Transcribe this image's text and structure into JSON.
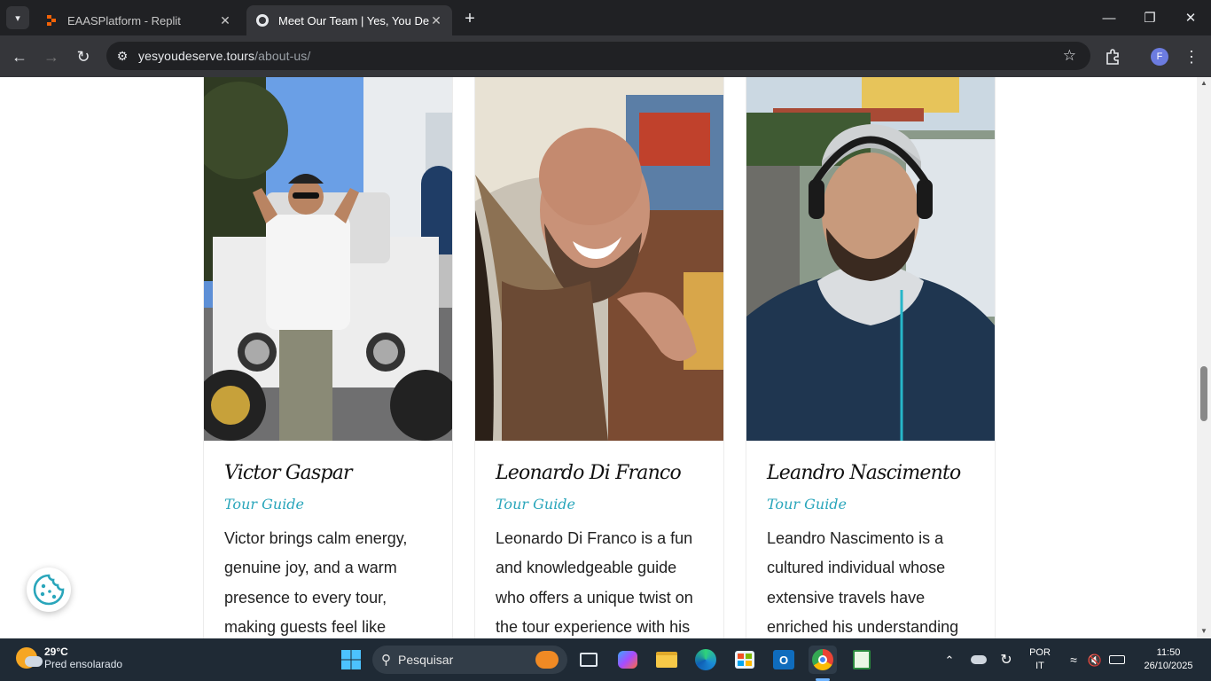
{
  "browser": {
    "tabs": [
      {
        "title": "EAASPlatform - Replit",
        "active": false
      },
      {
        "title": "Meet Our Team | Yes, You Deserve",
        "active": true
      }
    ],
    "url_domain": "yesyoudeserve.tours",
    "url_path": "/about-us/",
    "profile_initial": "F"
  },
  "team": [
    {
      "name": "Victor Gaspar",
      "role": "Tour Guide",
      "bio": "Victor brings calm energy, genuine joy, and a warm presence to every tour, making guests feel like"
    },
    {
      "name": "Leonardo Di Franco",
      "role": "Tour Guide",
      "bio": "Leonardo Di Franco is a fun and knowledgeable guide who offers a unique twist on the tour experience with his"
    },
    {
      "name": "Leandro Nascimento",
      "role": "Tour Guide",
      "bio": "Leandro Nascimento is a cultured individual whose extensive travels have enriched his understanding"
    }
  ],
  "taskbar": {
    "temperature": "29°C",
    "weather": "Pred ensolarado",
    "search_placeholder": "Pesquisar",
    "lang1": "POR",
    "lang2": "IT",
    "time": "11:50",
    "date": "26/10/2025"
  },
  "colors": {
    "accent": "#2aa6bb",
    "taskbar": "#1f2a35",
    "chrome_dark": "#202124"
  }
}
